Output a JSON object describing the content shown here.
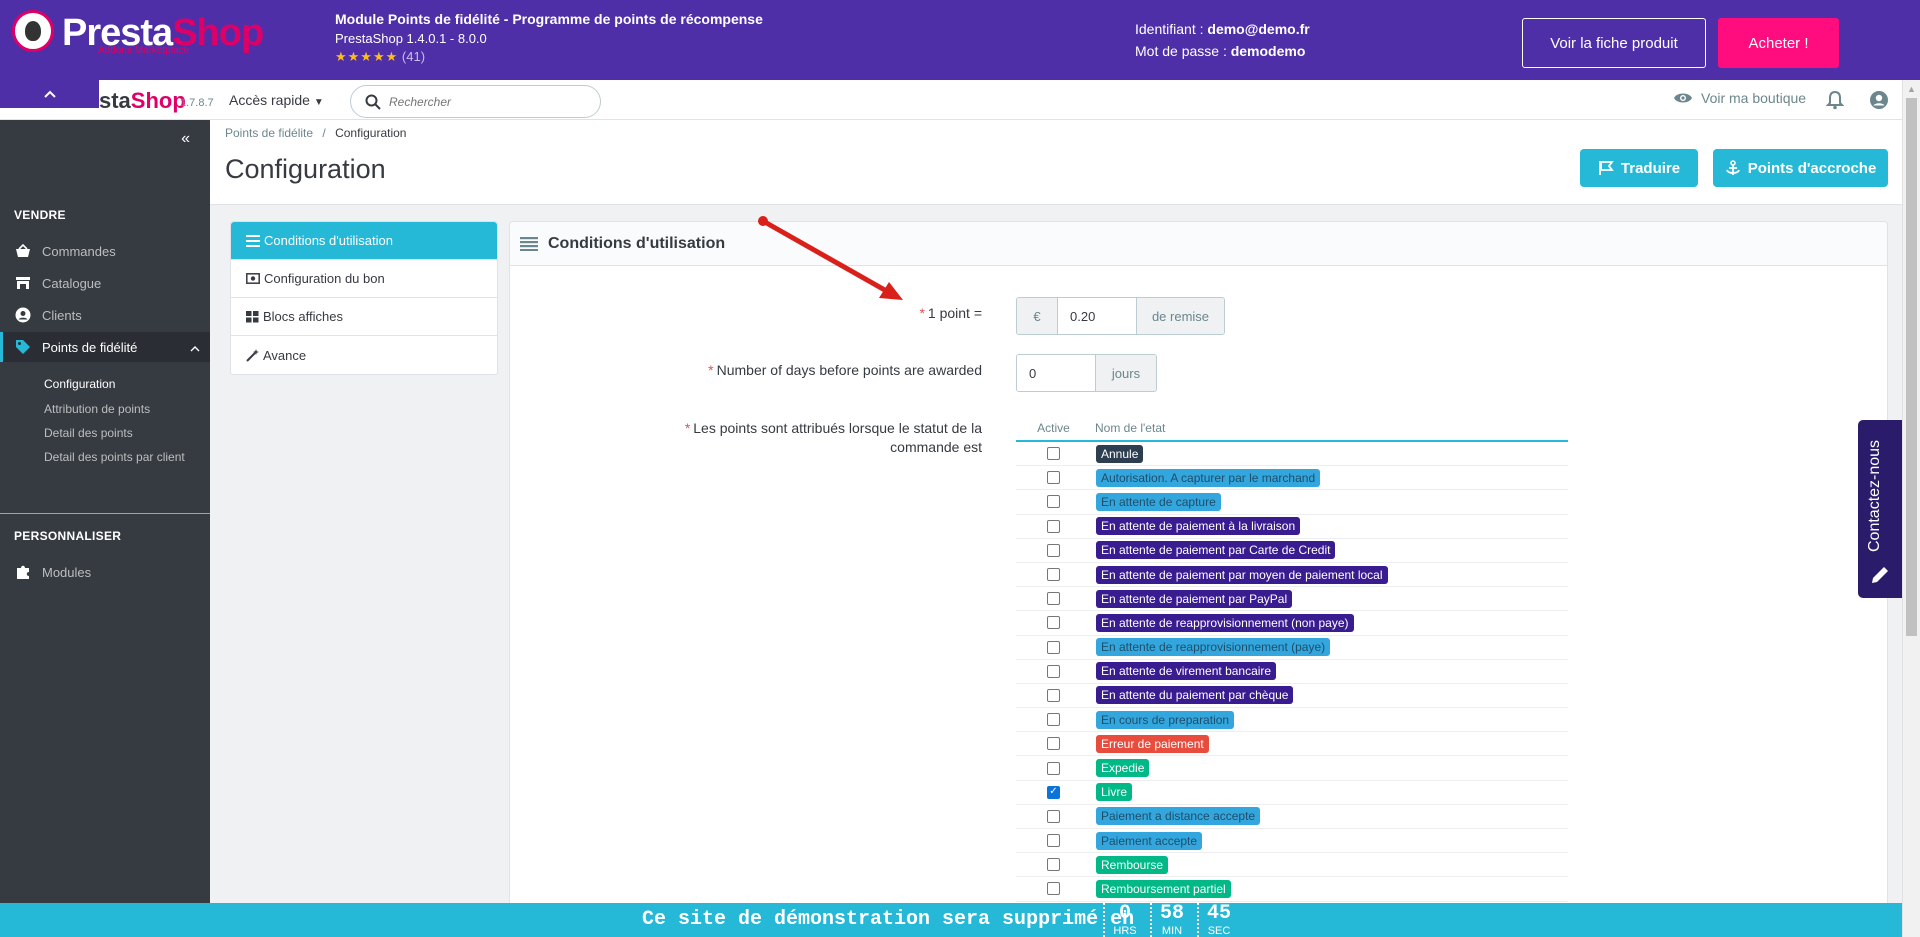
{
  "demo_banner": {
    "logo_word_1": "Presta",
    "logo_word_2": "Shop",
    "logo_sub": "Addons Marketplace",
    "module_title": "Module Points de fidélité - Programme de points de récompense",
    "module_versions": "PrestaShop 1.4.0.1 - 8.0.0",
    "stars": "★★★★★",
    "rating_count": "(41)",
    "creds_login_label": "Identifiant : ",
    "creds_login": "demo@demo.fr",
    "creds_pass_label": "Mot de passe : ",
    "creds_pass": "demodemo",
    "btn_fiche": "Voir la fiche produit",
    "btn_acheter": "Acheter !"
  },
  "header": {
    "logo_left": "sta",
    "logo_right": "Shop",
    "version": "1.7.8.7",
    "quick_access": "Accès rapide",
    "search_placeholder": "Rechercher",
    "view_shop": "Voir ma boutique"
  },
  "sidebar": {
    "section_sell": "VENDRE",
    "items": [
      {
        "label": "Commandes",
        "icon": "basket-icon"
      },
      {
        "label": "Catalogue",
        "icon": "store-icon"
      },
      {
        "label": "Clients",
        "icon": "account-icon"
      },
      {
        "label": "Points de fidélité",
        "icon": "tag-icon"
      }
    ],
    "sub_items": [
      "Configuration",
      "Attribution de points",
      "Detail des points",
      "Detail des points par client"
    ],
    "section_customize": "PERSONNALISER",
    "modules": "Modules"
  },
  "page": {
    "breadcrumb_parent": "Points de fidélite",
    "breadcrumb_sep": "/",
    "breadcrumb_current": "Configuration",
    "title": "Configuration",
    "btn_translate": "Traduire",
    "btn_hooks": "Points d'accroche"
  },
  "tabs": [
    {
      "label": "Conditions d'utilisation",
      "icon": "list-icon"
    },
    {
      "label": "Configuration du bon",
      "icon": "money-icon"
    },
    {
      "label": "Blocs affiches",
      "icon": "grid-icon"
    },
    {
      "label": "Avance",
      "icon": "wand-icon"
    }
  ],
  "panel": {
    "title": "Conditions d'utilisation",
    "field_point_label": "1 point =",
    "field_point_prefix": "€",
    "field_point_value": "0.20",
    "field_point_suffix": "de remise",
    "field_days_label": "Number of days before points are awarded",
    "field_days_value": "0",
    "field_days_suffix": "jours",
    "field_status_label_1": "Les points sont attribués lorsque le statut de la",
    "field_status_label_2": "commande est",
    "col_active": "Active",
    "col_name": "Nom de l'etat",
    "states": [
      {
        "name": "Annule",
        "color": "#2c3e50",
        "text": "#ffffff",
        "checked": false
      },
      {
        "name": "Autorisation. A capturer par le marchand",
        "color": "#34a6de",
        "text": "#1d4f6b",
        "checked": false
      },
      {
        "name": "En attente de capture",
        "color": "#34a6de",
        "text": "#1d4f6b",
        "checked": false
      },
      {
        "name": "En attente de paiement à la livraison",
        "color": "#3a1c91",
        "text": "#ffffff",
        "checked": false
      },
      {
        "name": "En attente de paiement par Carte de Credit",
        "color": "#3a1c91",
        "text": "#ffffff",
        "checked": false
      },
      {
        "name": "En attente de paiement par moyen de paiement local",
        "color": "#3a1c91",
        "text": "#ffffff",
        "checked": false
      },
      {
        "name": "En attente de paiement par PayPal",
        "color": "#3a1c91",
        "text": "#ffffff",
        "checked": false
      },
      {
        "name": "En attente de reapprovisionnement (non paye)",
        "color": "#3a1c91",
        "text": "#ffffff",
        "checked": false
      },
      {
        "name": "En attente de reapprovisionnement (paye)",
        "color": "#34a6de",
        "text": "#1d4f6b",
        "checked": false
      },
      {
        "name": "En attente de virement bancaire",
        "color": "#3a1c91",
        "text": "#ffffff",
        "checked": false
      },
      {
        "name": "En attente du paiement par chèque",
        "color": "#3a1c91",
        "text": "#ffffff",
        "checked": false
      },
      {
        "name": "En cours de preparation",
        "color": "#34a6de",
        "text": "#1d4f6b",
        "checked": false
      },
      {
        "name": "Erreur de paiement",
        "color": "#e74c3c",
        "text": "#ffffff",
        "checked": false
      },
      {
        "name": "Expedie",
        "color": "#01b887",
        "text": "#ffffff",
        "checked": false
      },
      {
        "name": "Livre",
        "color": "#01b887",
        "text": "#ffffff",
        "checked": true
      },
      {
        "name": "Paiement a distance accepte",
        "color": "#34a6de",
        "text": "#1d4f6b",
        "checked": false
      },
      {
        "name": "Paiement accepte",
        "color": "#34a6de",
        "text": "#1d4f6b",
        "checked": false
      },
      {
        "name": "Rembourse",
        "color": "#01b887",
        "text": "#ffffff",
        "checked": false
      },
      {
        "name": "Remboursement partiel",
        "color": "#01b887",
        "text": "#ffffff",
        "checked": false
      }
    ]
  },
  "contact_tab": "Contactez-nous",
  "countdown": {
    "message": "Ce site de démonstration sera supprimé en",
    "hours": "0",
    "hours_label": "HRS",
    "minutes": "58",
    "minutes_label": "MIN",
    "seconds": "45",
    "seconds_label": "SEC"
  },
  "colors": {
    "banner": "#4e2fa8",
    "accent": "#25b9d7",
    "sidebar": "#363a41",
    "buy": "#ff0c7f"
  }
}
